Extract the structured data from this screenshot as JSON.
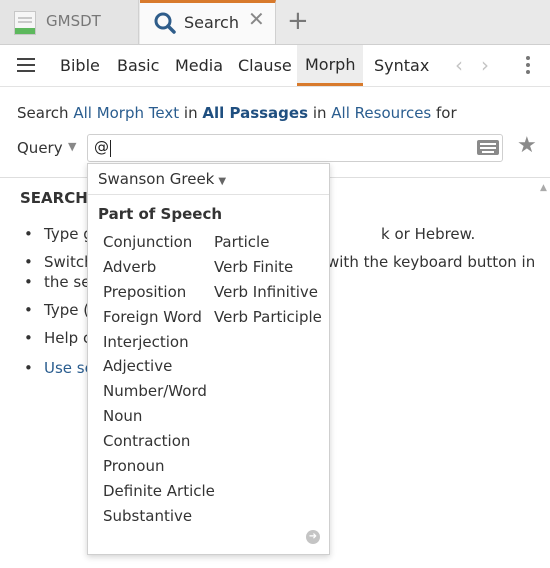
{
  "tabs": [
    {
      "label": "GMSDT"
    },
    {
      "label": "Search"
    }
  ],
  "icons": {
    "close": "✕",
    "add": "+",
    "chevron_left": "‹",
    "chevron_right": "›",
    "star": "★",
    "more": "➜"
  },
  "nav": {
    "items": [
      "Bible",
      "Basic",
      "Media",
      "Clause",
      "Morph",
      "Syntax"
    ],
    "active": "Morph"
  },
  "search_line": {
    "prefix": "Search",
    "text_scope": "All Morph Text",
    "in1": "in",
    "passages": "All Passages",
    "in2": "in",
    "resources": "All Resources",
    "suffix": "for"
  },
  "query": {
    "label": "Query",
    "caret": "▼",
    "value": "@"
  },
  "help": {
    "title": "SEARCH",
    "items": [
      "Type g",
      "Switch",
      "the se",
      "Type (",
      "Help c",
      "Use se"
    ],
    "right_fragments": {
      "line1": "k or Hebrew.",
      "line2": "with the keyboard button in"
    }
  },
  "popup": {
    "lexicon": "Swanson Greek",
    "section_title": "Part of Speech",
    "column1": [
      "Conjunction",
      "Adverb",
      "Preposition",
      "Foreign Word",
      "Interjection",
      "Adjective",
      "Number/Word",
      "Noun",
      "Contraction",
      "Pronoun",
      "Definite Article",
      "Substantive"
    ],
    "column2": [
      "Particle",
      "Verb Finite",
      "Verb Infinitive",
      "Verb Participle"
    ]
  },
  "colors": {
    "accent": "#d87a2c",
    "link": "#2a5d8f",
    "tabbar_bg": "#e9e9e9"
  }
}
